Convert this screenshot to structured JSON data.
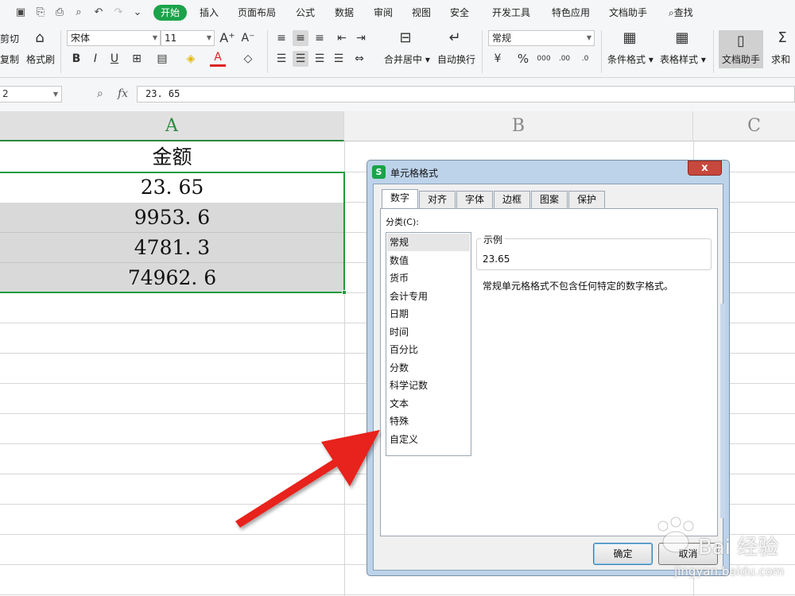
{
  "quick_access": [
    {
      "icon": "save-icon",
      "glyph": "▣"
    },
    {
      "icon": "save-as-icon",
      "glyph": "⎘"
    },
    {
      "icon": "print-icon",
      "glyph": "⎙"
    },
    {
      "icon": "print-preview-icon",
      "glyph": "⌕"
    },
    {
      "icon": "undo-icon",
      "glyph": "↶"
    },
    {
      "icon": "redo-icon",
      "glyph": "↷"
    },
    {
      "icon": "quick-access-more-icon",
      "glyph": "⌄"
    }
  ],
  "menu": {
    "start": "开始",
    "tabs": [
      "插入",
      "页面布局",
      "公式",
      "数据",
      "审阅",
      "视图",
      "安全",
      "开发工具",
      "特色应用",
      "文档助手"
    ],
    "search": "查找"
  },
  "ribbon": {
    "cut": "剪切",
    "copy": "复制",
    "format_painter": "格式刷",
    "font_name": "宋体",
    "font_size": "11",
    "merge_center": "合并居中",
    "wrap_text": "自动换行",
    "number_format": "常规",
    "conditional_format": "条件格式",
    "table_style": "表格样式",
    "doc_helper": "文档助手",
    "sum": "求和"
  },
  "formula_bar": {
    "name_box": "2",
    "fx": "fx",
    "value": "23. 65"
  },
  "sheet": {
    "columns": [
      "A",
      "B",
      "C"
    ],
    "header_cell": "金额",
    "values": [
      "23. 65",
      "9953. 6",
      "4781. 3",
      "74962. 6"
    ]
  },
  "dialog": {
    "title": "单元格格式",
    "app_icon_letter": "S",
    "close": "x",
    "tabs": [
      "数字",
      "对齐",
      "字体",
      "边框",
      "图案",
      "保护"
    ],
    "active_tab": "数字",
    "category_label": "分类(C):",
    "categories": [
      "常规",
      "数值",
      "货币",
      "会计专用",
      "日期",
      "时间",
      "百分比",
      "分数",
      "科学记数",
      "文本",
      "特殊",
      "自定义"
    ],
    "selected_category": "常规",
    "sample_label": "示例",
    "sample_value": "23.65",
    "description": "常规单元格格式不包含任何特定的数字格式。",
    "ok": "确定",
    "cancel": "取消"
  },
  "annotation_arrow_color": "#e8231f",
  "watermark": {
    "text": "Bai 经验",
    "url": "jingyan.baidu.com"
  }
}
